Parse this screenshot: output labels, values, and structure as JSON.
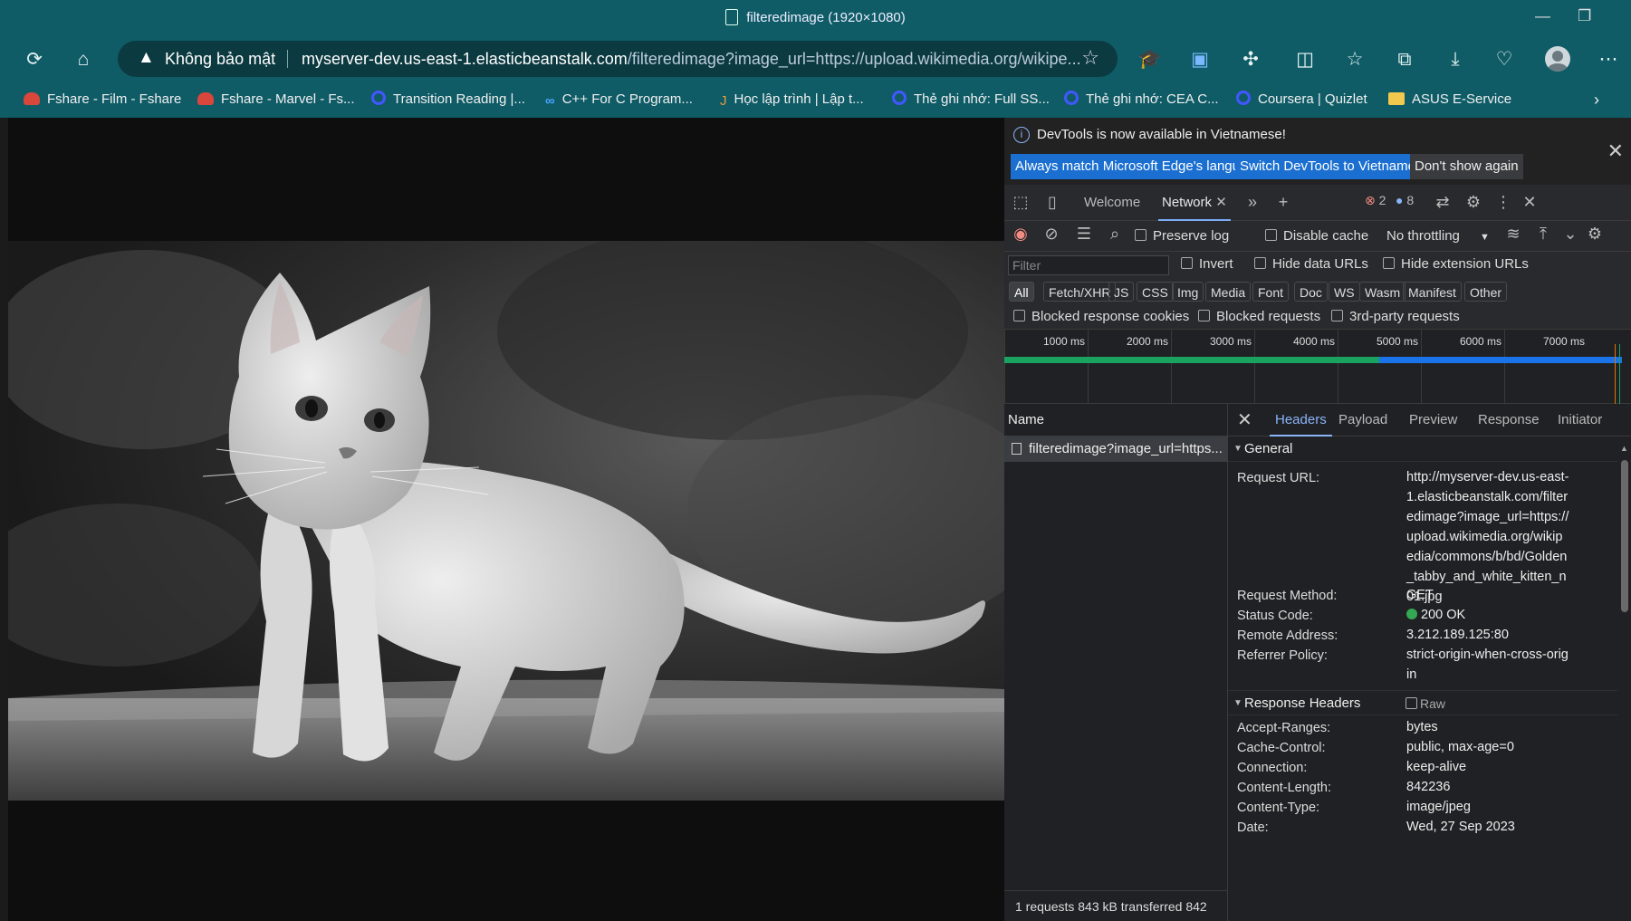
{
  "window": {
    "title": "filteredimage (1920×1080)"
  },
  "toolbar": {
    "security_label": "Không bảo mật",
    "url_host": "myserver-dev.us-east-1.elasticbeanstalk.com",
    "url_path": "/filteredimage?image_url=https://upload.wikimedia.org/wikipe..."
  },
  "bookmarks": [
    {
      "label": "Fshare - Film - Fshare",
      "icon": "fshare-icon"
    },
    {
      "label": "Fshare - Marvel - Fs...",
      "icon": "fshare-icon"
    },
    {
      "label": "Transition Reading |...",
      "icon": "quizlet-icon"
    },
    {
      "label": "C++ For C Program...",
      "icon": "coursera-icon"
    },
    {
      "label": "Học lập trình | Lập t...",
      "icon": "java-icon"
    },
    {
      "label": "Thẻ ghi nhớ: Full SS...",
      "icon": "quizlet-icon"
    },
    {
      "label": "Thẻ ghi nhớ: CEA C...",
      "icon": "quizlet-icon"
    },
    {
      "label": "Coursera | Quizlet",
      "icon": "quizlet-icon"
    },
    {
      "label": "ASUS E-Service",
      "icon": "folder-icon"
    }
  ],
  "devtools": {
    "banner": {
      "message": "DevTools is now available in Vietnamese!",
      "btn_match": "Always match Microsoft Edge's language",
      "btn_switch": "Switch DevTools to Vietnamese",
      "btn_dont_show": "Don't show again"
    },
    "tabs": {
      "welcome": "Welcome",
      "network": "Network",
      "errors": "2",
      "messages": "8"
    },
    "net_toolbar": {
      "preserve_log": "Preserve log",
      "disable_cache": "Disable cache",
      "throttling": "No throttling"
    },
    "filter": {
      "placeholder": "Filter",
      "invert": "Invert",
      "hide_data_urls": "Hide data URLs",
      "hide_extension_urls": "Hide extension URLs"
    },
    "types": [
      "All",
      "Fetch/XHR",
      "JS",
      "CSS",
      "Img",
      "Media",
      "Font",
      "Doc",
      "WS",
      "Wasm",
      "Manifest",
      "Other"
    ],
    "blocked": {
      "blocked_cookies": "Blocked response cookies",
      "blocked_requests": "Blocked requests",
      "third_party": "3rd-party requests"
    },
    "timeline": {
      "ticks": [
        "1000 ms",
        "2000 ms",
        "3000 ms",
        "4000 ms",
        "5000 ms",
        "6000 ms",
        "7000 ms"
      ],
      "colors": {
        "green": "#1aa260",
        "blue": "#1a73e8"
      }
    },
    "requests": {
      "name_header": "Name",
      "items": [
        "filteredimage?image_url=https..."
      ],
      "footer": "1 requests   843 kB transferred   842"
    },
    "details": {
      "tabs": [
        "Headers",
        "Payload",
        "Preview",
        "Response",
        "Initiator"
      ],
      "general_title": "General",
      "general": [
        {
          "key": "Request URL:",
          "value": "http://myserver-dev.us-east-1.elasticbeanstalk.com/filteredimage?image_url=https://upload.wikimedia.org/wikipedia/commons/b/bd/Golden_tabby_and_white_kitten_n01.jpg"
        },
        {
          "key": "Request Method:",
          "value": "GET"
        },
        {
          "key": "Status Code:",
          "value": "200 OK"
        },
        {
          "key": "Remote Address:",
          "value": "3.212.189.125:80"
        },
        {
          "key": "Referrer Policy:",
          "value": "strict-origin-when-cross-origin"
        }
      ],
      "response_title": "Response Headers",
      "raw_label": "Raw",
      "response": [
        {
          "key": "Accept-Ranges:",
          "value": "bytes"
        },
        {
          "key": "Cache-Control:",
          "value": "public, max-age=0"
        },
        {
          "key": "Connection:",
          "value": "keep-alive"
        },
        {
          "key": "Content-Length:",
          "value": "842236"
        },
        {
          "key": "Content-Type:",
          "value": "image/jpeg"
        },
        {
          "key": "Date:",
          "value": "Wed, 27 Sep 2023"
        }
      ]
    }
  }
}
